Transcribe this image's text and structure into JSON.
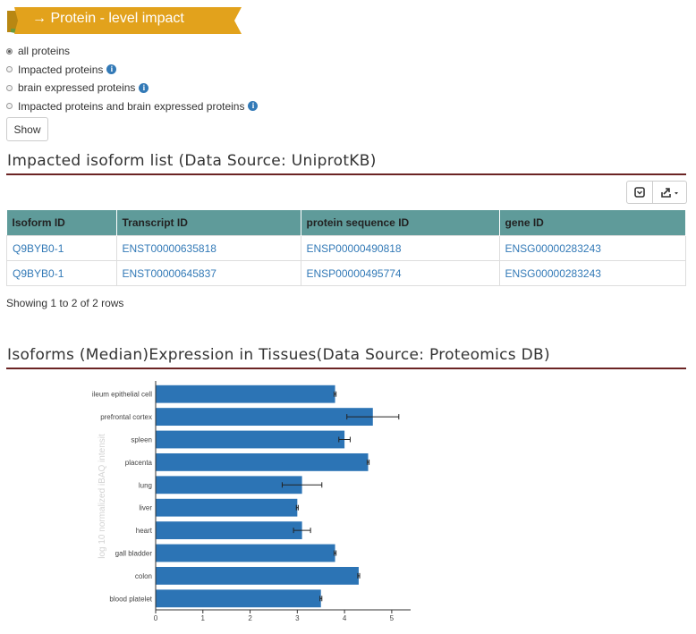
{
  "banner": {
    "title": "→ Protein - level impact"
  },
  "filters": [
    {
      "label": "all proteins",
      "checked": true,
      "info": false
    },
    {
      "label": "Impacted proteins",
      "checked": false,
      "info": true
    },
    {
      "label": "brain expressed proteins",
      "checked": false,
      "info": true
    },
    {
      "label": "Impacted proteins and brain expressed proteins",
      "checked": false,
      "info": true
    }
  ],
  "show_button": "Show",
  "isoform_section": {
    "title": "Impacted isoform list (Data Source: UniprotKB)",
    "columns": [
      "Isoform ID",
      "Transcript ID",
      "protein sequence ID",
      "gene ID"
    ],
    "rows": [
      [
        "Q9BYB0-1",
        "ENST00000635818",
        "ENSP00000490818",
        "ENSG00000283243"
      ],
      [
        "Q9BYB0-1",
        "ENST00000645837",
        "ENSP00000495774",
        "ENSG00000283243"
      ]
    ],
    "footer": "Showing 1 to 2 of 2 rows"
  },
  "expression_section": {
    "title": "Isoforms (Median)Expression in Tissues(Data Source: Proteomics DB)"
  },
  "chart_data": {
    "type": "bar",
    "orientation": "horizontal",
    "ylabel": "log 10 normalized iBAQ intensit",
    "xlim": [
      0,
      5.4
    ],
    "xticks": [
      0,
      1,
      2,
      3,
      4,
      5
    ],
    "color": "#2c74b5",
    "categories": [
      "ileum epithelial cell",
      "prefrontal cortex",
      "spleen",
      "placenta",
      "lung",
      "liver",
      "heart",
      "gall bladder",
      "colon",
      "blood platelet"
    ],
    "values": [
      3.8,
      4.6,
      4.0,
      4.5,
      3.1,
      3.0,
      3.1,
      3.8,
      4.3,
      3.5
    ],
    "errors": [
      0.02,
      0.55,
      0.12,
      0.02,
      0.42,
      0.02,
      0.18,
      0.02,
      0.02,
      0.02
    ]
  }
}
